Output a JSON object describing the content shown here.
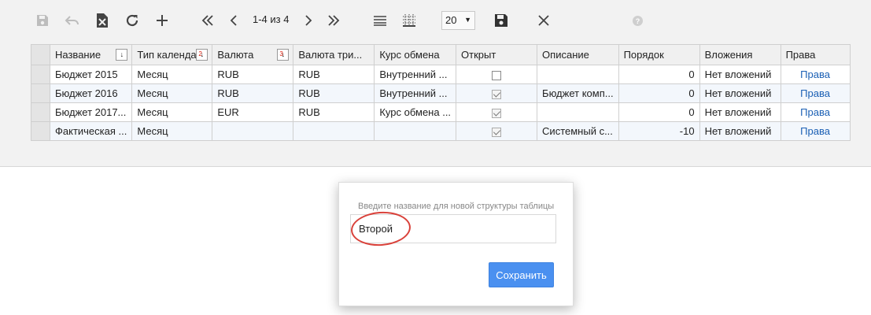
{
  "toolbar": {
    "page_info": "1-4 из 4",
    "page_size": "20"
  },
  "grid": {
    "columns": [
      "Название",
      "Тип календа",
      "Валюта",
      "Валюта три...",
      "Курс обмена",
      "Открыт",
      "Описание",
      "Порядок",
      "Вложения",
      "Права"
    ],
    "sort_badges": {
      "name": "",
      "calendar": "2",
      "currency": "3"
    },
    "rows": [
      {
        "name": "Бюджет 2015",
        "calendar": "Месяц",
        "currency": "RUB",
        "currency_tri": "RUB",
        "rate": "Внутренний ...",
        "open": false,
        "desc": "",
        "order": "0",
        "attach": "Нет вложений",
        "rights": "Права"
      },
      {
        "name": "Бюджет 2016",
        "calendar": "Месяц",
        "currency": "RUB",
        "currency_tri": "RUB",
        "rate": "Внутренний ...",
        "open": true,
        "desc": "Бюджет комп...",
        "order": "0",
        "attach": "Нет вложений",
        "rights": "Права"
      },
      {
        "name": "Бюджет 2017...",
        "calendar": "Месяц",
        "currency": "EUR",
        "currency_tri": "RUB",
        "rate": "Курс обмена ...",
        "open": true,
        "desc": "",
        "order": "0",
        "attach": "Нет вложений",
        "rights": "Права"
      },
      {
        "name": "Фактическая ...",
        "calendar": "Месяц",
        "currency": "",
        "currency_tri": "",
        "rate": "",
        "open": true,
        "desc": "Системный с...",
        "order": "-10",
        "attach": "Нет вложений",
        "rights": "Права"
      }
    ]
  },
  "dialog": {
    "label": "Введите название для новой структуры таблицы",
    "input_value": "Второй",
    "save_label": "Сохранить"
  },
  "colors": {
    "accent": "#4a90f0",
    "highlight_ring": "#d9413a",
    "link": "#1a5fb4"
  }
}
